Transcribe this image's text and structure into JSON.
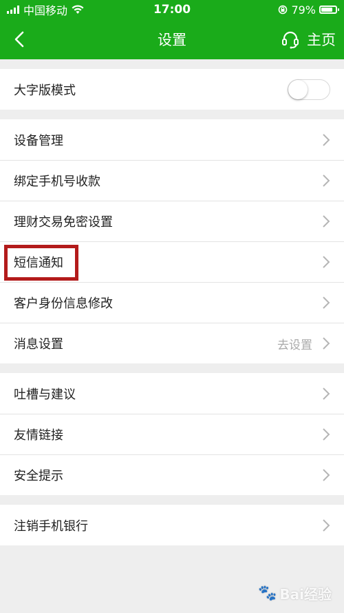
{
  "status_bar": {
    "carrier": "中国移动",
    "time": "17:00",
    "battery": "79%",
    "battery_level": 0.79
  },
  "nav": {
    "title": "设置",
    "home_label": "主页",
    "back_icon": "chevron-left-icon",
    "support_icon": "headset-icon"
  },
  "groups": [
    [
      {
        "label": "大字版模式",
        "type": "toggle",
        "on": false
      }
    ],
    [
      {
        "label": "设备管理"
      },
      {
        "label": "绑定手机号收款"
      },
      {
        "label": "理财交易免密设置"
      },
      {
        "label": "短信通知"
      },
      {
        "label": "客户身份信息修改"
      },
      {
        "label": "消息设置",
        "hint": "去设置"
      }
    ],
    [
      {
        "label": "吐槽与建议"
      },
      {
        "label": "友情链接"
      },
      {
        "label": "安全提示"
      }
    ],
    [
      {
        "label": "注销手机银行"
      }
    ]
  ],
  "watermark": "Bai经验",
  "colors": {
    "header_green": "#1aab1a",
    "highlight_red": "#b31b1b",
    "background": "#eeeeee"
  }
}
